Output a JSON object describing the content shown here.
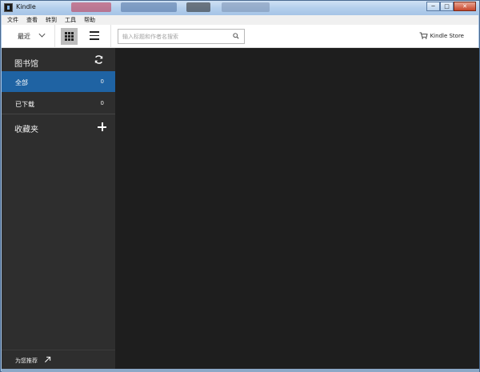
{
  "window": {
    "title": "Kindle",
    "controls": {
      "minimize": "─",
      "maximize": "□",
      "close": "✕"
    }
  },
  "menu": [
    "文件",
    "查看",
    "转到",
    "工具",
    "帮助"
  ],
  "toolbar": {
    "sort_label": "最近",
    "view_grid": "grid-view",
    "view_list": "list-view",
    "search_placeholder": "输入标题和作者名搜索",
    "store_label": "Kindle Store"
  },
  "sidebar": {
    "library_title": "图书馆",
    "items": [
      {
        "label": "全部",
        "count": "0",
        "active": true
      },
      {
        "label": "已下载",
        "count": "0",
        "active": false
      }
    ],
    "favorites_title": "收藏夹",
    "recommend_label": "为您推荐"
  },
  "colors": {
    "accent": "#1f63a3",
    "sidebar_bg": "#2e2e2e",
    "content_bg": "#1e1e1e"
  },
  "icons": [
    "app-icon",
    "chevron-down-icon",
    "grid-icon",
    "list-icon",
    "search-icon",
    "cart-icon",
    "sync-icon",
    "plus-icon",
    "external-link-icon"
  ]
}
